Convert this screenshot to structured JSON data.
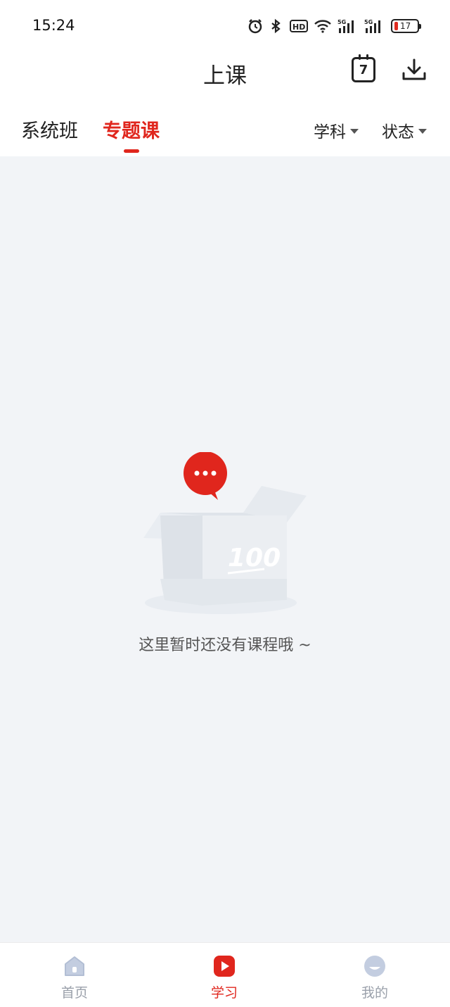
{
  "status_bar": {
    "time": "15:24",
    "battery": "17",
    "icons": [
      "alarm-icon",
      "bluetooth-icon",
      "hd-icon",
      "wifi-icon",
      "5g-signal-icon",
      "5g-signal-icon"
    ]
  },
  "header": {
    "title": "上课",
    "calendar_day": "7"
  },
  "tabs": [
    {
      "label": "系统班",
      "active": false
    },
    {
      "label": "专题课",
      "active": true
    }
  ],
  "filters": {
    "subject": "学科",
    "status": "状态"
  },
  "empty_state": {
    "message": "这里暂时还没有课程哦 ~",
    "box_label": "100"
  },
  "bottom_nav": [
    {
      "label": "首页",
      "active": false
    },
    {
      "label": "学习",
      "active": true
    },
    {
      "label": "我的",
      "active": false
    }
  ],
  "colors": {
    "accent": "#e0261d",
    "background": "#f2f4f7",
    "inactive": "#9aa0aa"
  }
}
